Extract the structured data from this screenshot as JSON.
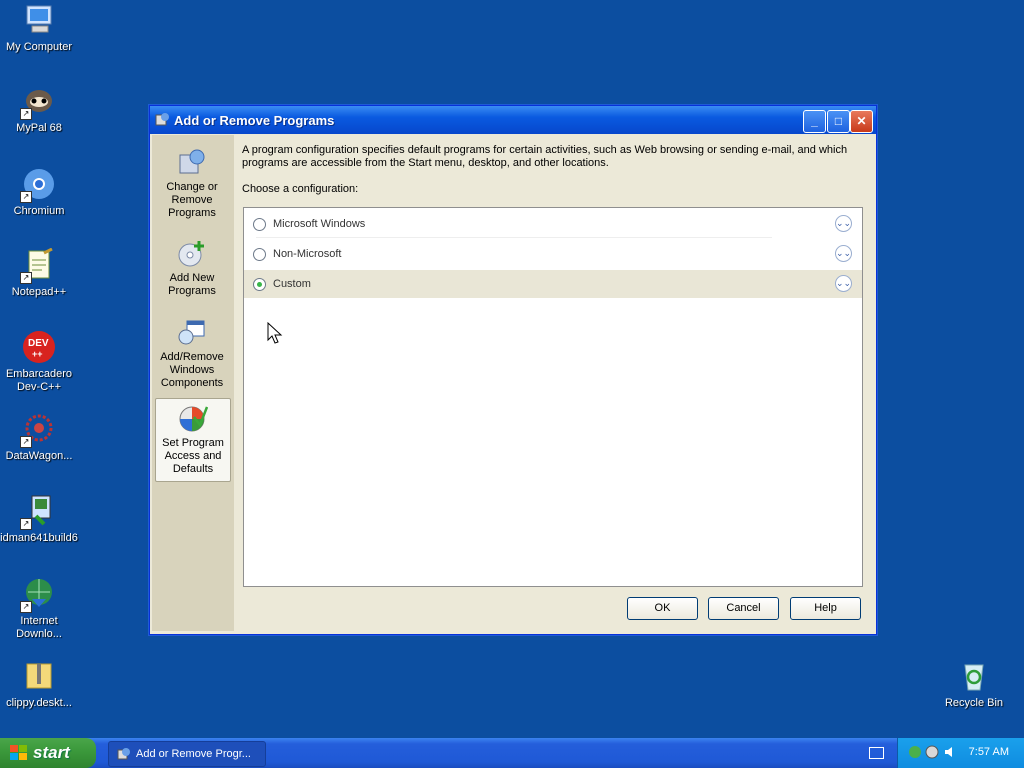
{
  "desktop": {
    "icons": [
      {
        "label": "My Computer"
      },
      {
        "label": "MyPal 68"
      },
      {
        "label": "Chromium"
      },
      {
        "label": "Notepad++"
      },
      {
        "label": "Embarcadero\nDev-C++"
      },
      {
        "label": "DataWagon..."
      },
      {
        "label": "idman641build6"
      },
      {
        "label": "Internet\nDownlo..."
      },
      {
        "label": "clippy.deskt..."
      },
      {
        "label": "Recycle Bin"
      }
    ]
  },
  "window": {
    "title": "Add or Remove Programs",
    "sidebar": [
      {
        "label": "Change or\nRemove\nPrograms"
      },
      {
        "label": "Add New\nPrograms"
      },
      {
        "label": "Add/Remove\nWindows\nComponents"
      },
      {
        "label": "Set Program\nAccess and\nDefaults"
      }
    ],
    "description": "A program configuration specifies default programs for certain activities, such as Web browsing or sending e-mail, and which programs are accessible from the Start menu, desktop, and other locations.",
    "choose_label": "Choose a configuration:",
    "configurations": [
      {
        "label": "Microsoft Windows",
        "selected": false
      },
      {
        "label": "Non-Microsoft",
        "selected": false
      },
      {
        "label": "Custom",
        "selected": true
      }
    ],
    "buttons": {
      "ok": "OK",
      "cancel": "Cancel",
      "help": "Help"
    }
  },
  "taskbar": {
    "start_label": "start",
    "task_label": "Add or Remove Progr...",
    "clock": "7:57 AM"
  },
  "colors": {
    "desktop": "#0c4ea0",
    "titlebar": "#0a5ae0",
    "start": "#3c9a3c"
  }
}
